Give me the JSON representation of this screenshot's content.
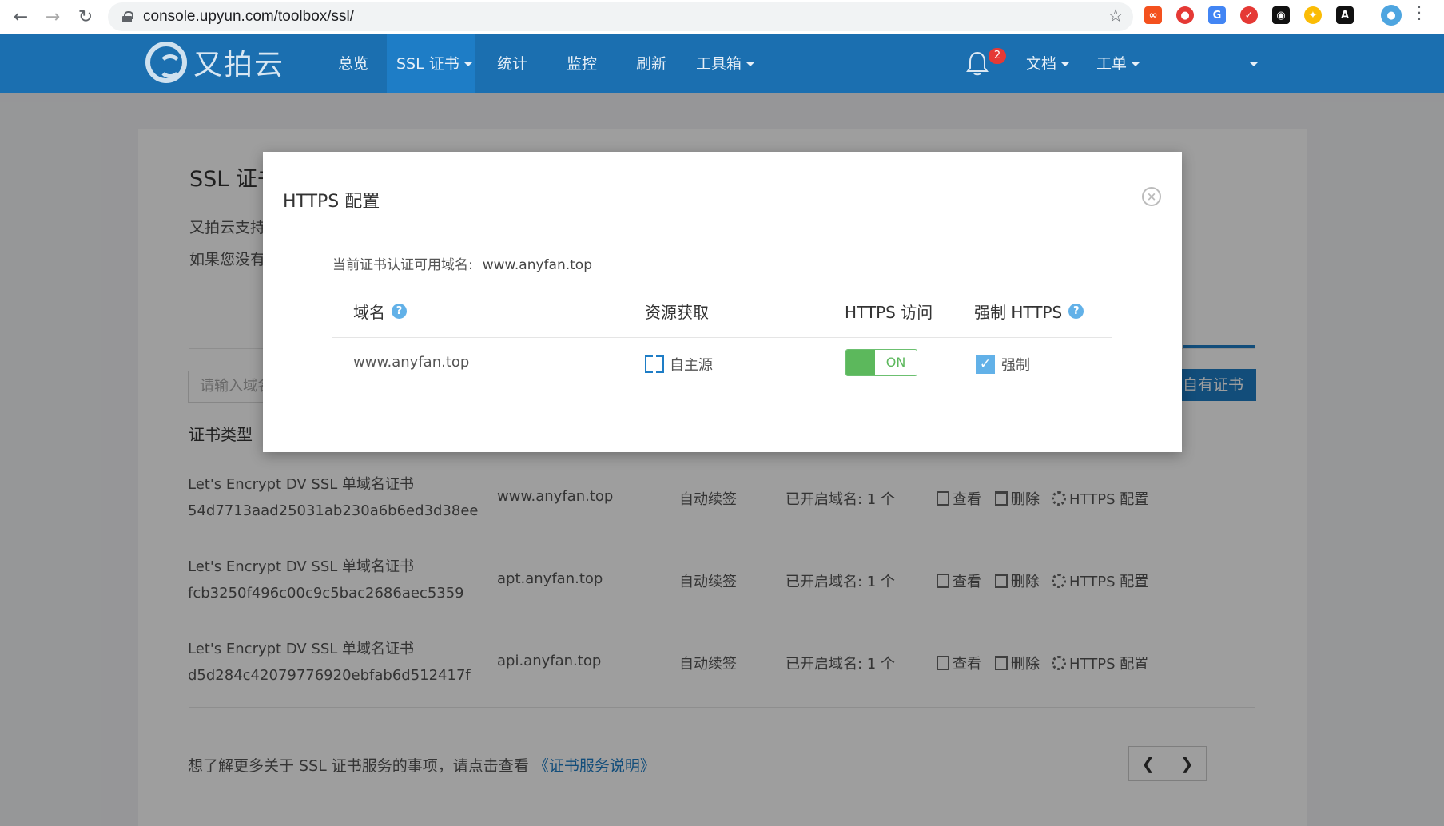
{
  "browser": {
    "url": "console.upyun.com/toolbox/ssl/"
  },
  "nav": {
    "logo_text": "又拍云",
    "items": [
      "总览",
      "SSL 证书",
      "统计",
      "监控",
      "刷新",
      "工具箱"
    ],
    "notification_count": "2",
    "docs": "文档",
    "ticket": "工单"
  },
  "page": {
    "title": "SSL 证书",
    "intro1": "又拍云支持",
    "intro2": "如果您没有",
    "search_placeholder": "请输入域名",
    "add_button": "自有证书",
    "col_type": "证书类型",
    "rows": [
      {
        "type": "Let's Encrypt DV SSL 单域名证书",
        "id": "54d7713aad25031ab230a6b6ed3d38ee",
        "domain": "www.anyfan.top",
        "renew": "自动续签",
        "enabled": "已开启域名: 1 个"
      },
      {
        "type": "Let's Encrypt DV SSL 单域名证书",
        "id": "fcb3250f496c00c9c5bac2686aec5359",
        "domain": "apt.anyfan.top",
        "renew": "自动续签",
        "enabled": "已开启域名: 1 个"
      },
      {
        "type": "Let's Encrypt DV SSL 单域名证书",
        "id": "d5d284c42079776920ebfab6d512417f",
        "domain": "api.anyfan.top",
        "renew": "自动续签",
        "enabled": "已开启域名: 1 个"
      }
    ],
    "actions": {
      "view": "查看",
      "delete": "删除",
      "https": "HTTPS 配置"
    },
    "footnote_prefix": "想了解更多关于 SSL 证书服务的事项，请点击查看",
    "footnote_link": "《证书服务说明》"
  },
  "modal": {
    "title": "HTTPS 配置",
    "current_domain_label": "当前证书认证可用域名:",
    "current_domain_value": "www.anyfan.top",
    "headers": {
      "domain": "域名",
      "source": "资源获取",
      "https_access": "HTTPS 访问",
      "force_https": "强制 HTTPS"
    },
    "row": {
      "domain": "www.anyfan.top",
      "source": "自主源",
      "toggle": "ON",
      "force": "强制"
    }
  }
}
